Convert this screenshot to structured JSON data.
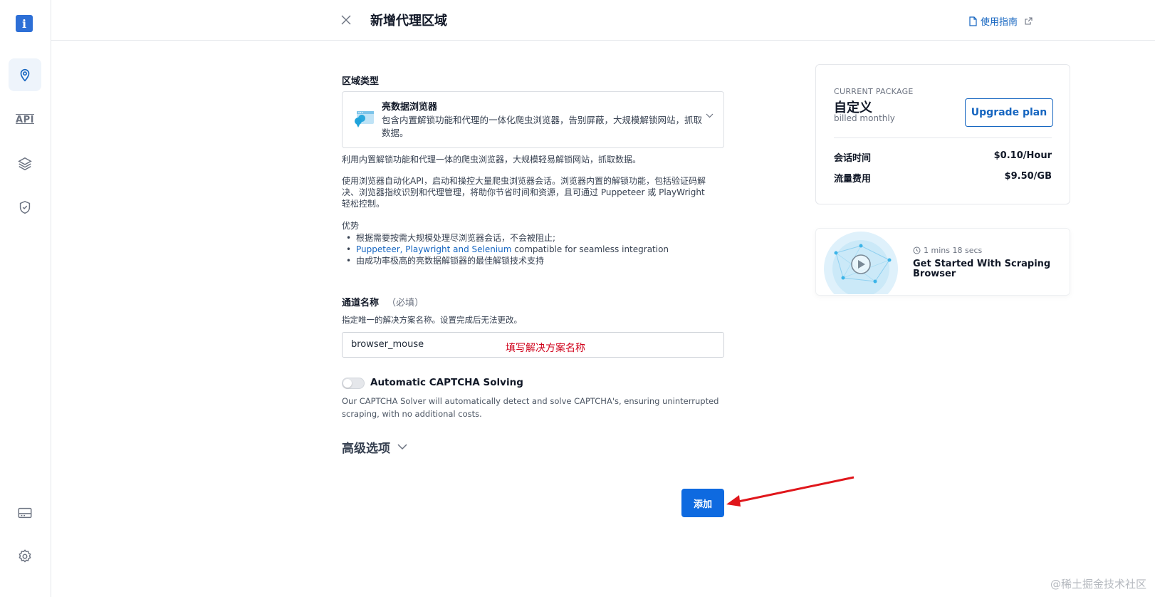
{
  "app": {
    "logo_glyph": "i"
  },
  "header": {
    "title": "新增代理区域",
    "guide_label": "使用指南"
  },
  "sidebar": {
    "items": [
      {
        "name": "location-pin-icon",
        "active": true
      },
      {
        "name": "api-icon",
        "label": "API",
        "active": false
      },
      {
        "name": "layers-icon",
        "active": false
      },
      {
        "name": "shield-check-icon",
        "active": false
      },
      {
        "name": "billing-card-icon",
        "active": false
      },
      {
        "name": "settings-gear-icon",
        "active": false
      }
    ]
  },
  "zone_type": {
    "label": "区域类型",
    "selected_title": "亮数据浏览器",
    "selected_desc": "包含内置解锁功能和代理的一体化爬虫浏览器，告别屏蔽，大规模解锁网站，抓取数据。",
    "summary": "利用内置解锁功能和代理一体的爬虫浏览器，大规模轻易解锁网站，抓取数据。",
    "description": "使用浏览器自动化API，启动和操控大量爬虫浏览器会话。浏览器内置的解锁功能，包括验证码解决、浏览器指纹识别和代理管理，将助你节省时间和资源，且可通过 Puppeteer 或 PlayWright 轻松控制。",
    "advantages_title": "优势",
    "advantages": [
      {
        "text": "根据需要按需大规模处理尽浏览器会话，不会被阻止;",
        "link": ""
      },
      {
        "link": "Puppeteer, Playwright and Selenium",
        "text": " compatible for seamless integration"
      },
      {
        "text": "由成功率极高的亮数据解锁器的最佳解锁技术支持",
        "link": ""
      }
    ]
  },
  "channel": {
    "label": "通道名称",
    "required_hint": "（必填）",
    "help": "指定唯一的解决方案名称。设置完成后无法更改。",
    "value": "browser_mouse",
    "annotation": "填写解决方案名称"
  },
  "captcha": {
    "label": "Automatic CAPTCHA Solving",
    "enabled": false,
    "desc": "Our CAPTCHA Solver will automatically detect and solve CAPTCHA's, ensuring uninterrupted scraping, with no additional costs."
  },
  "advanced": {
    "label": "高级选项"
  },
  "submit": {
    "label": "添加"
  },
  "package": {
    "caption": "CURRENT PACKAGE",
    "name": "自定义",
    "billing": "billed monthly",
    "upgrade_label": "Upgrade plan",
    "rows": [
      {
        "label": "会话时间",
        "value": "$0.10/Hour"
      },
      {
        "label": "流量费用",
        "value": "$9.50/GB"
      }
    ]
  },
  "video": {
    "duration": "1 mins 18 secs",
    "title": "Get Started With Scraping Browser"
  },
  "watermark": "@稀土掘金技术社区",
  "colors": {
    "primary": "#0e6ae0",
    "link": "#1565c0",
    "annotation": "#d0021b"
  }
}
